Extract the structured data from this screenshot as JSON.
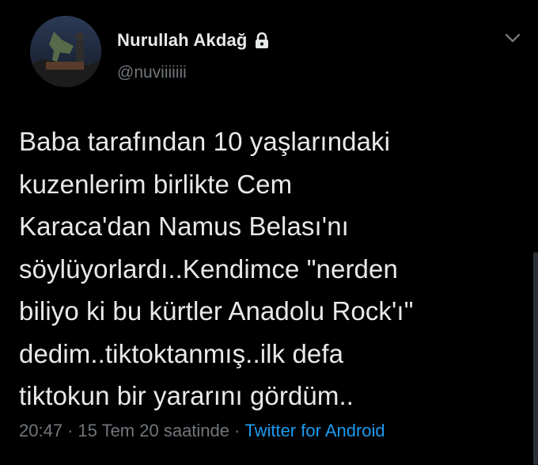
{
  "user": {
    "display_name": "Nurullah Akdağ",
    "handle": "@nuviiiiiii",
    "protected_icon": "lock-icon",
    "avatar_icon": "avatar"
  },
  "menu": {
    "icon": "chevron-down-icon"
  },
  "tweet": {
    "text": "Baba tarafından 10 yaşlarındaki\nkuzenlerim birlikte Cem\nKaraca'dan Namus Belası'nı\nsöylüyorlardı..Kendimce \"nerden\nbiliyo ki bu kürtler Anadolu Rock'ı\"\ndedim..tiktoktanmış..ilk defa\ntiktokun bir yararını gördüm..",
    "time": "20:47",
    "date": "15 Tem 20 saatinde",
    "separator": "·",
    "source": "Twitter for Android"
  },
  "colors": {
    "background": "#000000",
    "text_primary": "#e7e9ea",
    "text_secondary": "#71767b",
    "link": "#1d9bf0"
  }
}
